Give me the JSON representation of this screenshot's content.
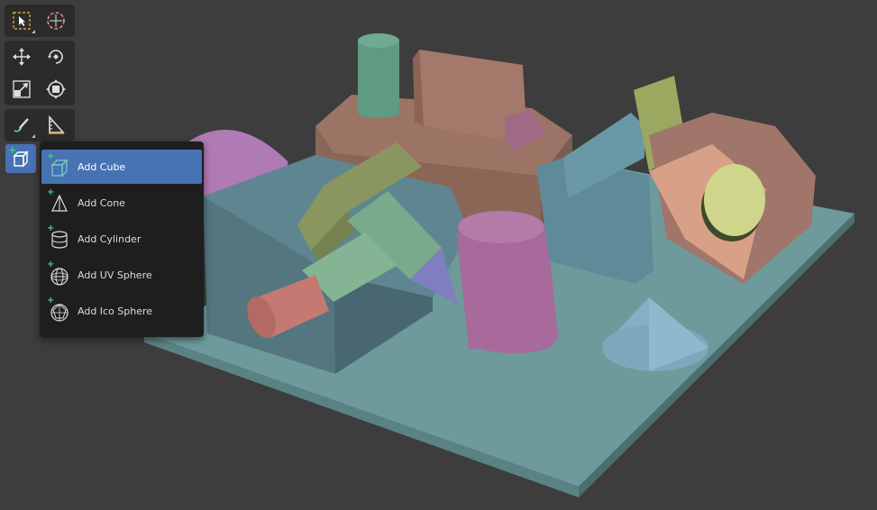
{
  "colors": {
    "background": "#3d3d3d",
    "toolbar": "#2b2b2b",
    "menu_bg": "#1e1e1e",
    "highlight": "#4772b3",
    "add_plus": "#4fd07a"
  },
  "toolbar": {
    "tools": [
      {
        "icon": "select-box-icon",
        "active": false
      },
      {
        "icon": "cursor-icon",
        "active": false
      },
      {
        "icon": "move-icon",
        "active": false
      },
      {
        "icon": "rotate-icon",
        "active": false
      },
      {
        "icon": "scale-icon",
        "active": false
      },
      {
        "icon": "transform-icon",
        "active": false
      },
      {
        "icon": "annotate-icon",
        "active": false
      },
      {
        "icon": "measure-icon",
        "active": false
      },
      {
        "icon": "add-cube-icon",
        "active": true
      }
    ]
  },
  "add_menu": {
    "items": [
      {
        "label": "Add Cube",
        "icon": "cube-icon",
        "highlighted": true
      },
      {
        "label": "Add Cone",
        "icon": "cone-icon",
        "highlighted": false
      },
      {
        "label": "Add Cylinder",
        "icon": "cylinder-icon",
        "highlighted": false
      },
      {
        "label": "Add UV Sphere",
        "icon": "uv-sphere-icon",
        "highlighted": false
      },
      {
        "label": "Add Ico Sphere",
        "icon": "ico-sphere-icon",
        "highlighted": false
      }
    ]
  }
}
